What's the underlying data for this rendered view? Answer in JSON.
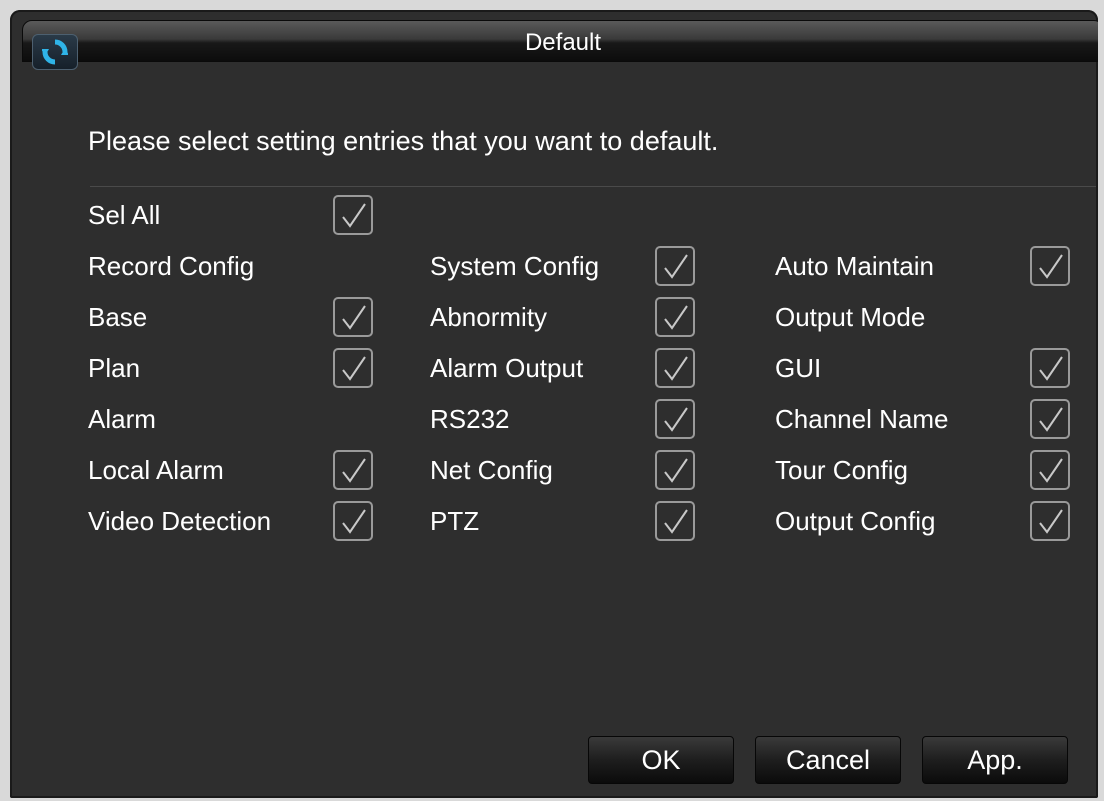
{
  "window": {
    "title": "Default",
    "icon": "refresh-icon"
  },
  "instruction": "Please select setting entries that you want to default.",
  "select_all": {
    "label": "Sel All",
    "checked": true
  },
  "columns": [
    [
      {
        "label": "Record Config",
        "has_checkbox": false
      },
      {
        "label": "Base",
        "has_checkbox": true,
        "checked": true
      },
      {
        "label": "Plan",
        "has_checkbox": true,
        "checked": true
      },
      {
        "label": "Alarm",
        "has_checkbox": false
      },
      {
        "label": "Local Alarm",
        "has_checkbox": true,
        "checked": true
      },
      {
        "label": "Video Detection",
        "has_checkbox": true,
        "checked": true
      }
    ],
    [
      {
        "label": "System Config",
        "has_checkbox": true,
        "checked": true
      },
      {
        "label": "Abnormity",
        "has_checkbox": true,
        "checked": true
      },
      {
        "label": "Alarm Output",
        "has_checkbox": true,
        "checked": true
      },
      {
        "label": "RS232",
        "has_checkbox": true,
        "checked": true
      },
      {
        "label": "Net Config",
        "has_checkbox": true,
        "checked": true
      },
      {
        "label": "PTZ",
        "has_checkbox": true,
        "checked": true
      }
    ],
    [
      {
        "label": "Auto Maintain",
        "has_checkbox": true,
        "checked": true
      },
      {
        "label": "Output Mode",
        "has_checkbox": false
      },
      {
        "label": "GUI",
        "has_checkbox": true,
        "checked": true
      },
      {
        "label": "Channel Name",
        "has_checkbox": true,
        "checked": true
      },
      {
        "label": "Tour Config",
        "has_checkbox": true,
        "checked": true
      },
      {
        "label": "Output Config",
        "has_checkbox": true,
        "checked": true
      }
    ]
  ],
  "buttons": {
    "ok": "OK",
    "cancel": "Cancel",
    "apply": "App."
  },
  "colors": {
    "background": "#2e2e2e",
    "text": "#ffffff",
    "checkbox_border": "#9a9a9a",
    "icon_accent": "#2fb4e8"
  }
}
